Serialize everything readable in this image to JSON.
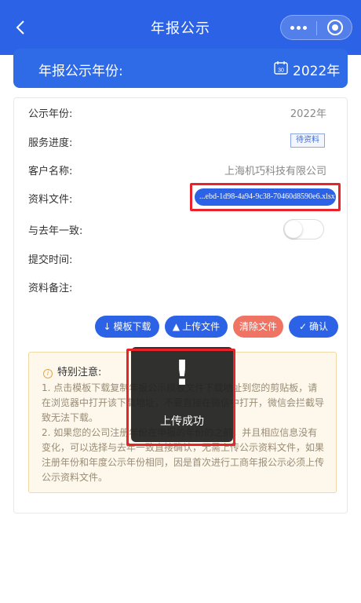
{
  "navbar": {
    "title": "年报公示",
    "accent": "#2c63e6"
  },
  "banner": {
    "label": "年报公示年份:",
    "calendar_icon_text": "30",
    "year": "2022年"
  },
  "form": {
    "rows": [
      {
        "label": "公示年份:",
        "value": "2022年"
      },
      {
        "label": "服务进度:",
        "badge": "待资料"
      },
      {
        "label": "客户名称:",
        "value": "上海机巧科技有限公司"
      },
      {
        "label": "资料文件:",
        "file": "...ebd-1d98-4a94-9c38-70460d8590e6.xlsx"
      },
      {
        "label": "与去年一致:",
        "toggle": false
      },
      {
        "label": "提交时间:",
        "value": ""
      },
      {
        "label": "资料备注:",
        "value": ""
      }
    ]
  },
  "actions": {
    "download": "模板下载",
    "upload": "上传文件",
    "clear": "清除文件",
    "confirm": "确认"
  },
  "notice": {
    "title": "特别注意:",
    "p1": "1. 点击模板下载复制年报公示模板文件下载地址到您的剪贴板，请在浏览器中打开该下载地址，不要直接在微信中打开，微信会拦截导致无法下载。",
    "p2": "2. 如果您的公司注册年份在申报的年份的之前，并且相应信息没有变化，可以选择与去年一致直接确认，无需上传公示资料文件，如果注册年份和年度公示年份相同，因是首次进行工商年报公示必须上传公示资料文件。"
  },
  "toast": {
    "icon": "!",
    "message": "上传成功"
  },
  "colors": {
    "primary": "#2c63e6",
    "danger": "#ef7463",
    "highlight": "#e8242a",
    "notice_bg": "#fdf7ec"
  }
}
